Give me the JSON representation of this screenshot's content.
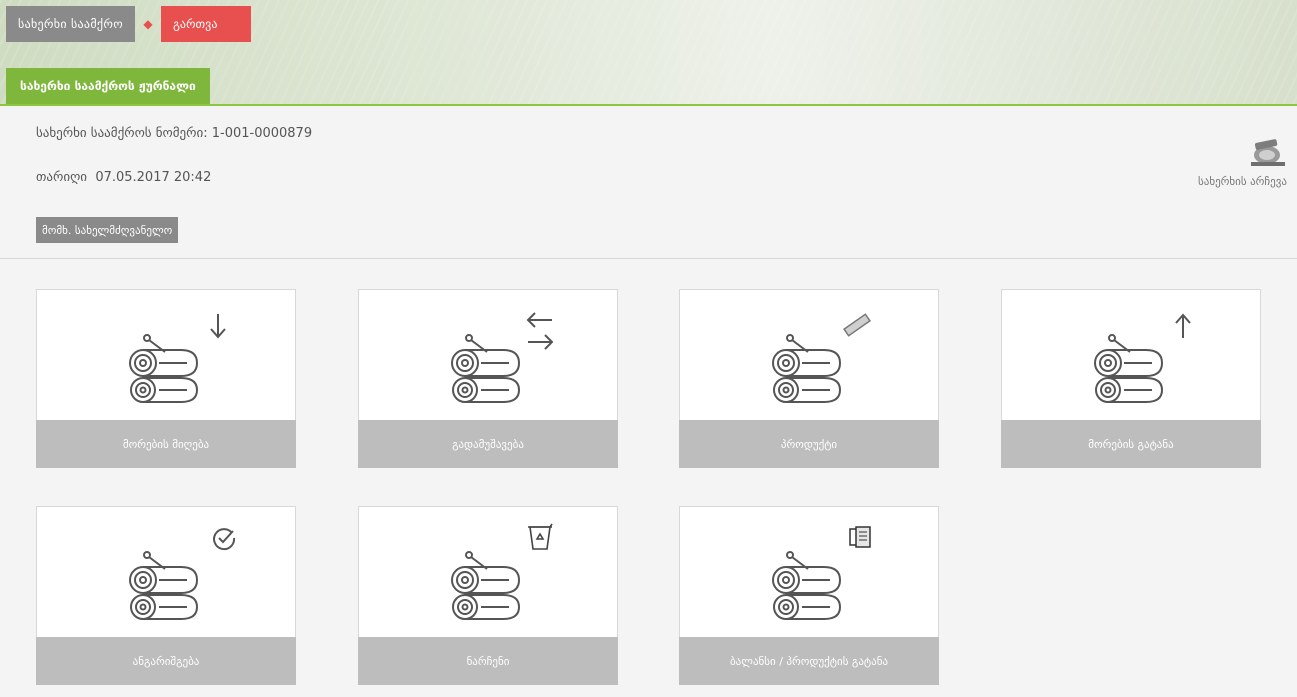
{
  "header": {
    "home_label": "სახერხი საამქრო",
    "logout_label": "გართვა",
    "journal_tab": "სახერხი საამქროს ჟურნალი"
  },
  "info": {
    "number_label": "სახერხი საამქროს ნომერი:",
    "number_value": "1-001-0000879",
    "date_label": "თარიღი",
    "date_value": "07.05.2017 20:42",
    "manager_button": "მომხ. სახელმძღვანელო",
    "archive_label": "სახერხის არჩევა"
  },
  "tiles": [
    {
      "label": "მორების მიღება",
      "icon": "arrow-down-icon"
    },
    {
      "label": "გადამუშავება",
      "icon": "arrows-exchange-icon"
    },
    {
      "label": "პროდუქტი",
      "icon": "plank-icon"
    },
    {
      "label": "მორების გატანა",
      "icon": "arrow-up-icon"
    },
    {
      "label": "ანგარიშგება",
      "icon": "check-circle-icon"
    },
    {
      "label": "ნარჩენი",
      "icon": "waste-bin-icon"
    },
    {
      "label": "ბალანსი / პროდუქტის გატანა",
      "icon": "documents-icon"
    }
  ],
  "colors": {
    "accent_green": "#7fb73d",
    "logout_red": "#e84f4f",
    "button_grey": "#8a8a8a",
    "tile_footer": "#bdbdbd"
  }
}
